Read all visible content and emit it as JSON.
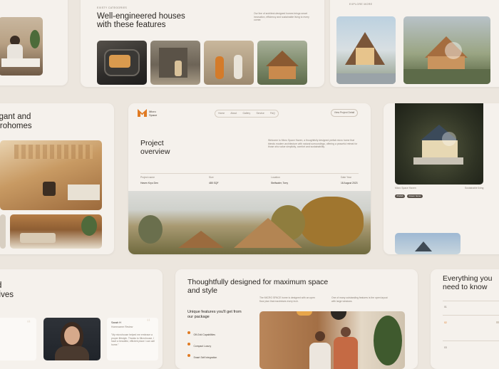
{
  "card1": {
    "eyebrow": "EXISTY CATEGORIES",
    "heading": "Well-engineered houses with these features",
    "blurb": "Our line of architect-designed homes brings smart innovation, efficiency and sustainable living to every corner."
  },
  "card2": {
    "eyebrow": "EXPLORE MORE"
  },
  "card3": {
    "heading": "Elegant and Microhomes"
  },
  "card4": {
    "logo": "Micro Space",
    "nav": [
      "Home",
      "About",
      "Gallery",
      "Service",
      "FAQ"
    ],
    "cta": "View Project Detail",
    "title": "Project overview",
    "intro": "Welcome to Micro Space Haven, a thoughtfully designed prefab micro home that blends modern architecture with natural surroundings, offering a peaceful retreat for those who value simplicity, comfort and sustainability.",
    "meta": [
      {
        "label": "Project name",
        "value": "Haven Kryo Den"
      },
      {
        "label": "Size",
        "value": "485 SQF"
      },
      {
        "label": "Location",
        "value": "Steifwaler, Torry"
      },
      {
        "label": "Date Year",
        "value": "18 August 2023"
      }
    ]
  },
  "card5": {
    "caption_left": "Micro Space Haven",
    "caption_right": "Sustainable living",
    "tags": [
      "Prefab",
      "Green home"
    ]
  },
  "card6": {
    "heading": "Thoughtfully designed for maximum space and style",
    "intro": "The MICRO SPACE home is designed with an open floor plan that maximises every inch.",
    "aside": "One of many outstanding features is the open layout with large windows.",
    "features_title": "Unique features you'll get from our package",
    "features": [
      "Off-Grid Capabilities",
      "Compact Luxury",
      "Smart Self Integration"
    ]
  },
  "card7": {
    "heading_lines": [
      "d",
      "lives"
    ]
  },
  "card8": {
    "name": "Sarah H",
    "role": "Homeowner Review",
    "quote": "\"My microhouse helped me embrace a proper lifestyle. Thanks to Microhouse, I have a beautiful, efficient place I can call home.\""
  },
  "card9": {
    "heading": "Everything you need to know",
    "faq": [
      "01",
      "02",
      "03"
    ]
  }
}
